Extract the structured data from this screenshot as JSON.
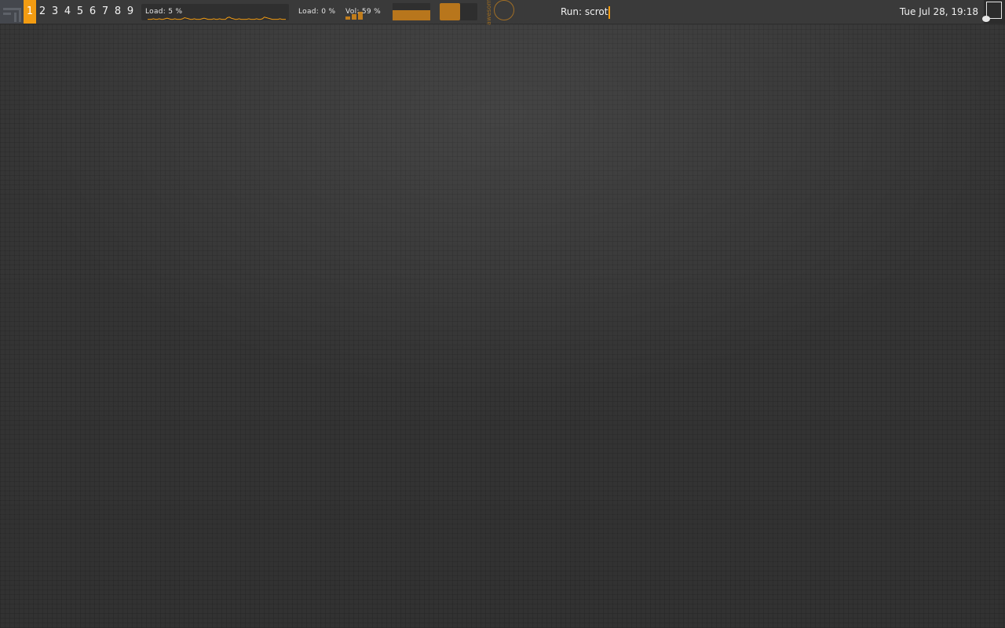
{
  "taglist": {
    "tags": [
      "1",
      "2",
      "3",
      "4",
      "5",
      "6",
      "7",
      "8",
      "9"
    ],
    "active_index": 0
  },
  "widgets": {
    "cpu_label": "Load:  5 %",
    "cpu_graph_values": [
      2,
      2,
      2,
      3,
      2,
      2,
      3,
      2,
      2,
      3,
      4,
      3,
      2,
      2,
      3,
      2,
      2,
      2,
      3,
      5,
      4,
      3,
      2,
      2,
      3,
      2,
      2,
      2,
      3,
      4,
      3,
      2,
      2,
      2,
      3,
      2,
      2,
      3,
      2,
      2,
      2,
      5,
      6,
      4,
      3,
      2,
      2,
      3,
      2,
      2,
      2,
      2,
      3,
      2,
      2,
      2,
      3,
      2,
      2,
      3,
      6,
      5,
      4,
      3,
      2,
      2,
      2,
      2,
      3,
      2,
      2,
      2
    ],
    "mem_label": "Load:  0 %",
    "volume_label": "Vol: 59 %",
    "volume_level": 0.59,
    "battery_level": 0.6,
    "toggle_on": true,
    "launcher_text": "awesome",
    "run_prompt": "Run: scrot",
    "clock": "Tue Jul 28, 19:18"
  },
  "colors": {
    "accent": "#f39c12",
    "bar_bg": "#3a3a3a",
    "widget_fill": "#b8761c",
    "desktop_bg": "#373737"
  },
  "icons": {
    "logo": "awesome-logo-icon",
    "layout": "layout-floating-icon",
    "ring": "circle-icon"
  }
}
